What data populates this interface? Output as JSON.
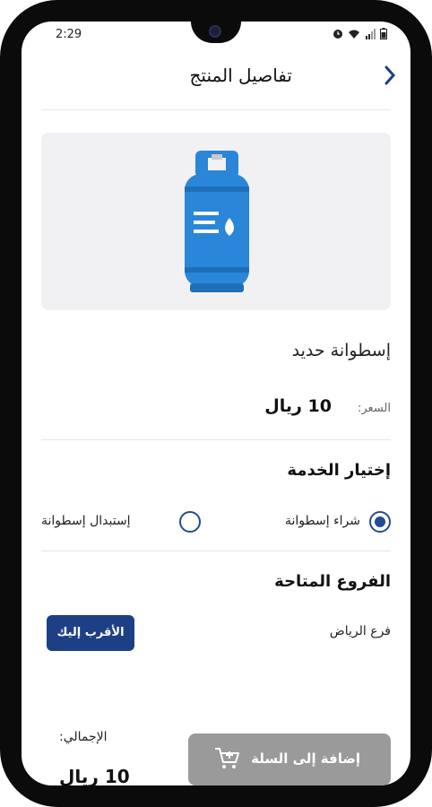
{
  "status_bar": {
    "time": "2:29"
  },
  "header": {
    "title": "تفاصيل المنتج",
    "back_icon": "chevron-left-icon"
  },
  "product": {
    "name": "إسطوانة حديد",
    "price_label": "السعر:",
    "price_value": "10 ريال"
  },
  "service": {
    "heading": "إختيار الخدمة",
    "options": [
      {
        "label": "شراء إسطوانة",
        "selected": true
      },
      {
        "label": "إستبدال إسطوانة",
        "selected": false
      }
    ]
  },
  "branches": {
    "heading": "الفروع المتاحة",
    "branch_name": "فرع الرياض",
    "nearest_button": "الأقرب إليك"
  },
  "footer": {
    "total_label": "الإجمالي:",
    "total_value": "10 ريال",
    "add_to_cart": "إضافة إلى السلة"
  },
  "colors": {
    "accent": "#1d3f86",
    "cylinder": "#2a86d8",
    "disabled_button": "#9a9a9a"
  }
}
